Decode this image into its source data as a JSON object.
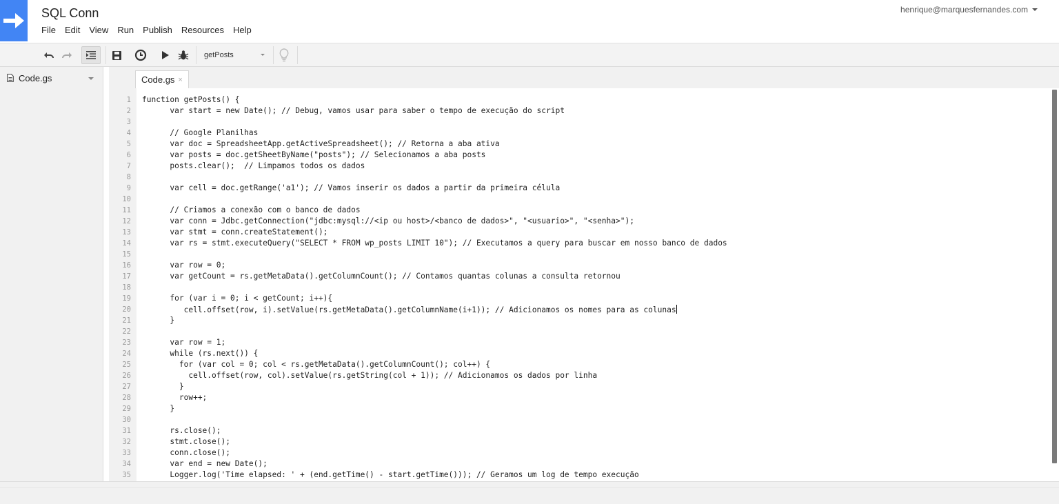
{
  "header": {
    "app_title": "SQL Conn",
    "account_email": "henrique@marquesfernandes.com",
    "menu": [
      "File",
      "Edit",
      "View",
      "Run",
      "Publish",
      "Resources",
      "Help"
    ]
  },
  "toolbar": {
    "function_selected": "getPosts",
    "icons": [
      "undo-icon",
      "redo-icon",
      "indent-icon",
      "save-icon",
      "triggers-icon",
      "run-icon",
      "debug-icon",
      "lightbulb-icon"
    ]
  },
  "sidebar": {
    "file_name": "Code.gs"
  },
  "editor": {
    "tab_label": "Code.gs",
    "tab_close": "×",
    "cursor_line": 20,
    "lines": [
      "function getPosts() {",
      "      var start = new Date(); // Debug, vamos usar para saber o tempo de execução do script",
      "",
      "      // Google Planilhas",
      "      var doc = SpreadsheetApp.getActiveSpreadsheet(); // Retorna a aba ativa",
      "      var posts = doc.getSheetByName(\"posts\"); // Selecionamos a aba posts",
      "      posts.clear();  // Limpamos todos os dados",
      "",
      "      var cell = doc.getRange('a1'); // Vamos inserir os dados a partir da primeira célula",
      "",
      "      // Criamos a conexão com o banco de dados",
      "      var conn = Jdbc.getConnection(\"jdbc:mysql://<ip ou host>/<banco de dados>\", \"<usuario>\", \"<senha>\");",
      "      var stmt = conn.createStatement();",
      "      var rs = stmt.executeQuery(\"SELECT * FROM wp_posts LIMIT 10\"); // Executamos a query para buscar em nosso banco de dados",
      "",
      "      var row = 0;",
      "      var getCount = rs.getMetaData().getColumnCount(); // Contamos quantas colunas a consulta retornou",
      "",
      "      for (var i = 0; i < getCount; i++){",
      "         cell.offset(row, i).setValue(rs.getMetaData().getColumnName(i+1)); // Adicionamos os nomes para as colunas",
      "      }",
      "",
      "      var row = 1;",
      "      while (rs.next()) {",
      "        for (var col = 0; col < rs.getMetaData().getColumnCount(); col++) {",
      "          cell.offset(row, col).setValue(rs.getString(col + 1)); // Adicionamos os dados por linha",
      "        }",
      "        row++;",
      "      }",
      "",
      "      rs.close();",
      "      stmt.close();",
      "      conn.close();",
      "      var end = new Date();",
      "      Logger.log('Time elapsed: ' + (end.getTime() - start.getTime())); // Geramos um log de tempo execução"
    ]
  }
}
